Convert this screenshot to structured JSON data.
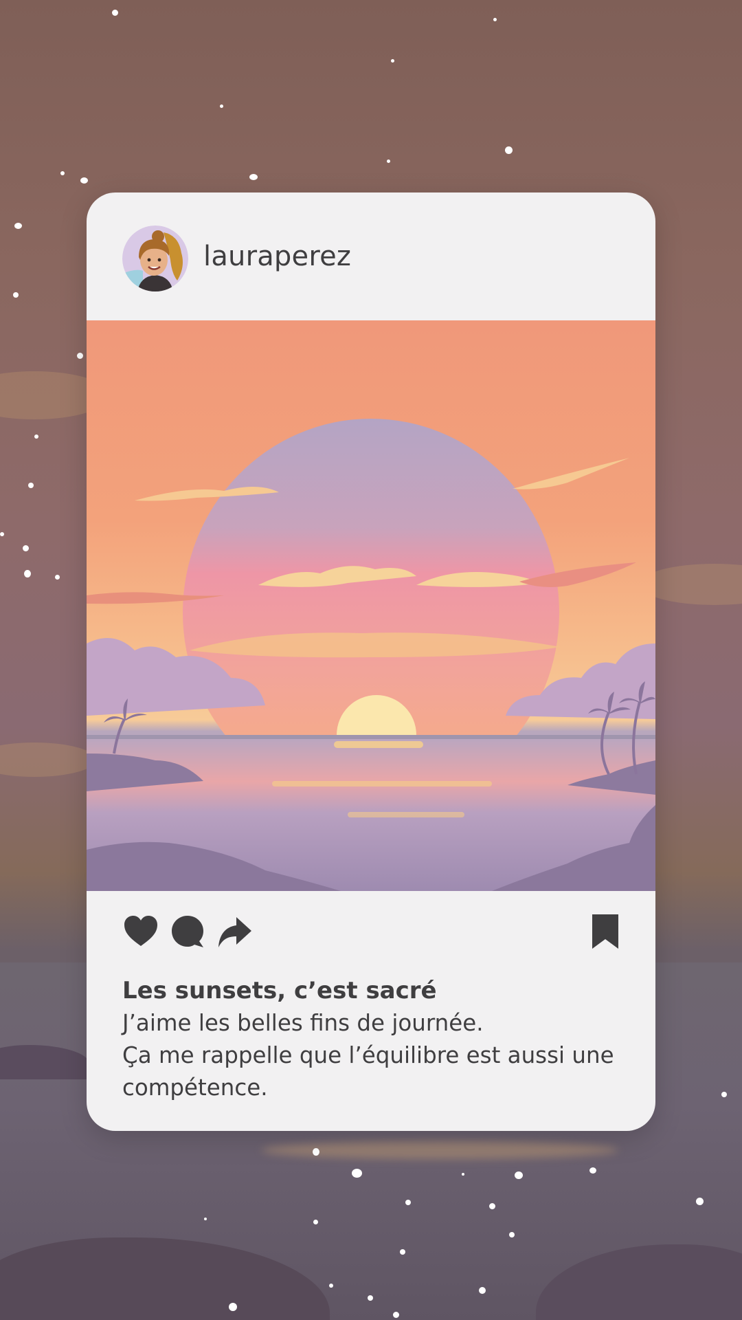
{
  "post": {
    "username": "lauraperez",
    "caption": {
      "title": "Les sunsets, c’est sacré",
      "line1": "J’aime les belles fins de journée.",
      "line2": "Ça me rappelle que l’équilibre est aussi une compétence."
    }
  },
  "icons": {
    "like": "heart-icon",
    "comment": "comment-bubble-icon",
    "share": "share-arrow-icon",
    "save": "bookmark-icon"
  },
  "colors": {
    "card": "#f2f1f2",
    "text": "#3f3e40",
    "sky_orange": "#f2a27b",
    "sun_disc_pink": "#ef9aa6",
    "sea_lilac": "#a998b8"
  }
}
